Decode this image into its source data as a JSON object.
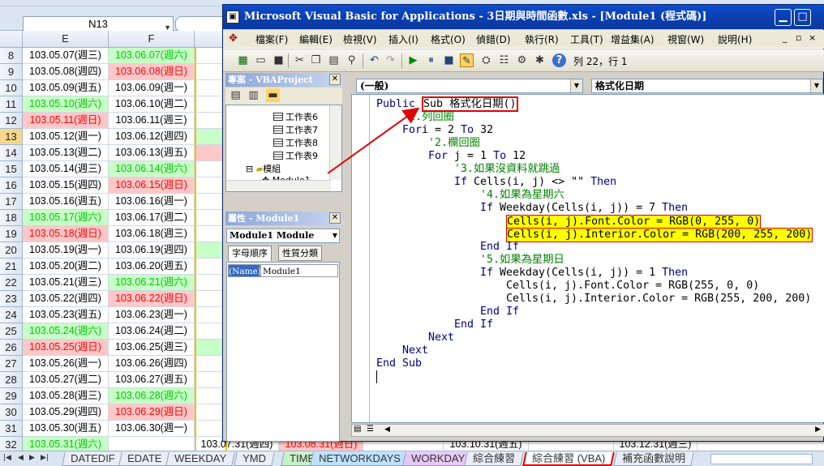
{
  "excel": {
    "name_box": "N13",
    "columns": [
      "E",
      "F"
    ],
    "active_row": "13",
    "rows": [
      {
        "num": "8",
        "e": "103.05.07(週三)",
        "ec": "",
        "f": "103.06.07(週六)",
        "fc": "sat"
      },
      {
        "num": "9",
        "e": "103.05.08(週四)",
        "ec": "",
        "f": "103.06.08(週日)",
        "fc": "sun"
      },
      {
        "num": "10",
        "e": "103.05.09(週五)",
        "ec": "",
        "f": "103.06.09(週一)",
        "fc": ""
      },
      {
        "num": "11",
        "e": "103.05.10(週六)",
        "ec": "sat",
        "f": "103.06.10(週二)",
        "fc": ""
      },
      {
        "num": "12",
        "e": "103.05.11(週日)",
        "ec": "sun",
        "f": "103.06.11(週三)",
        "fc": ""
      },
      {
        "num": "13",
        "e": "103.05.12(週一)",
        "ec": "",
        "f": "103.06.12(週四)",
        "fc": ""
      },
      {
        "num": "14",
        "e": "103.05.13(週二)",
        "ec": "",
        "f": "103.06.13(週五)",
        "fc": ""
      },
      {
        "num": "15",
        "e": "103.05.14(週三)",
        "ec": "",
        "f": "103.06.14(週六)",
        "fc": "sat"
      },
      {
        "num": "16",
        "e": "103.05.15(週四)",
        "ec": "",
        "f": "103.06.15(週日)",
        "fc": "sun"
      },
      {
        "num": "17",
        "e": "103.05.16(週五)",
        "ec": "",
        "f": "103.06.16(週一)",
        "fc": ""
      },
      {
        "num": "18",
        "e": "103.05.17(週六)",
        "ec": "sat",
        "f": "103.06.17(週二)",
        "fc": ""
      },
      {
        "num": "19",
        "e": "103.05.18(週日)",
        "ec": "sun",
        "f": "103.06.18(週三)",
        "fc": ""
      },
      {
        "num": "20",
        "e": "103.05.19(週一)",
        "ec": "",
        "f": "103.06.19(週四)",
        "fc": ""
      },
      {
        "num": "21",
        "e": "103.05.20(週二)",
        "ec": "",
        "f": "103.06.20(週五)",
        "fc": ""
      },
      {
        "num": "22",
        "e": "103.05.21(週三)",
        "ec": "",
        "f": "103.06.21(週六)",
        "fc": "sat"
      },
      {
        "num": "23",
        "e": "103.05.22(週四)",
        "ec": "",
        "f": "103.06.22(週日)",
        "fc": "sun"
      },
      {
        "num": "24",
        "e": "103.05.23(週五)",
        "ec": "",
        "f": "103.06.23(週一)",
        "fc": ""
      },
      {
        "num": "25",
        "e": "103.05.24(週六)",
        "ec": "sat",
        "f": "103.06.24(週二)",
        "fc": ""
      },
      {
        "num": "26",
        "e": "103.05.25(週日)",
        "ec": "sun",
        "f": "103.06.25(週三)",
        "fc": ""
      },
      {
        "num": "27",
        "e": "103.05.26(週一)",
        "ec": "",
        "f": "103.06.26(週四)",
        "fc": ""
      },
      {
        "num": "28",
        "e": "103.05.27(週二)",
        "ec": "",
        "f": "103.06.27(週五)",
        "fc": ""
      },
      {
        "num": "29",
        "e": "103.05.28(週三)",
        "ec": "",
        "f": "103.06.28(週六)",
        "fc": "sat"
      },
      {
        "num": "30",
        "e": "103.05.29(週四)",
        "ec": "",
        "f": "103.06.29(週日)",
        "fc": "sun"
      },
      {
        "num": "31",
        "e": "103.05.30(週五)",
        "ec": "",
        "f": "103.06.30(週一)",
        "fc": ""
      },
      {
        "num": "32",
        "e": "103.05.31(週六)",
        "ec": "sat",
        "f": "",
        "fc": ""
      }
    ],
    "peek_g": [
      "",
      "",
      "",
      "",
      "",
      "sat",
      "sun",
      "",
      "",
      "",
      "",
      "",
      "sat",
      "",
      "",
      "",
      "",
      "",
      "sat",
      "",
      "",
      "",
      "",
      "",
      ""
    ],
    "row32_extra": [
      "103.07.31(週四)",
      "103.08.31(週日)",
      "103.10.31(週五)",
      "103.12.31(週三)"
    ],
    "sheet_tabs": [
      "DATEDIF",
      "EDATE",
      "WEEKDAY",
      "YMD",
      "TIME",
      "NETWORKDAYS",
      "WORKDAY",
      "綜合練習",
      "綜合練習 (VBA)",
      "補充函數說明"
    ],
    "active_tab": "綜合練習 (VBA)",
    "tab_colors": {
      "TIME": "#c8f0c8",
      "NETWORKDAYS": "#bde1ff",
      "WORKDAY": "#e8c8f8"
    }
  },
  "vba": {
    "title": "Microsoft Visual Basic for Applications - 3日期與時間函數.xls - [Module1 (程式碼)]",
    "menu": [
      "檔案(F)",
      "編輯(E)",
      "檢視(V)",
      "插入(I)",
      "格式(O)",
      "偵錯(D)",
      "執行(R)",
      "工具(T)",
      "增益集(A)",
      "視窗(W)",
      "說明(H)"
    ],
    "position": "列 22，行 1",
    "project_title": "專案 - VBAProject",
    "tree": [
      "工作表6",
      "工作表7",
      "工作表8",
      "工作表9"
    ],
    "modules_folder": "模組",
    "module_item": "Module1",
    "props_title": "屬性 - Module1",
    "props_combo": "Module1 Module",
    "props_tabs": [
      "字母順序",
      "性質分類"
    ],
    "props_name_key": "(Name)",
    "props_name_val": "Module1",
    "combo_object": "(一般)",
    "combo_proc": "格式化日期",
    "code": [
      {
        "indent": 0,
        "parts": [
          [
            "kw",
            "Public "
          ],
          [
            "box",
            "Sub 格式化日期()"
          ]
        ]
      },
      {
        "indent": 1,
        "parts": [
          [
            "cm",
            "'1.列回圈"
          ]
        ]
      },
      {
        "indent": 1,
        "parts": [
          [
            "kw",
            "For"
          ],
          [
            "",
            "i = 2 "
          ],
          [
            "kw",
            "To"
          ],
          [
            "",
            " 32"
          ]
        ]
      },
      {
        "indent": 2,
        "parts": [
          [
            "cm",
            "'2.欄回圈"
          ]
        ]
      },
      {
        "indent": 2,
        "parts": [
          [
            "kw",
            "For"
          ],
          [
            "",
            " j = 1 "
          ],
          [
            "kw",
            "To"
          ],
          [
            "",
            " 12"
          ]
        ]
      },
      {
        "indent": 3,
        "parts": [
          [
            "cm",
            "'3.如果沒資料就跳過"
          ]
        ]
      },
      {
        "indent": 3,
        "parts": [
          [
            "kw",
            "If"
          ],
          [
            "",
            " Cells(i, j) <> \"\" "
          ],
          [
            "kw",
            "Then"
          ]
        ]
      },
      {
        "indent": 4,
        "parts": [
          [
            "cm",
            "'4.如果為星期六"
          ]
        ]
      },
      {
        "indent": 4,
        "parts": [
          [
            "kw",
            "If"
          ],
          [
            "",
            " Weekday(Cells(i, j)) = 7 "
          ],
          [
            "kw",
            "Then"
          ]
        ]
      },
      {
        "indent": 5,
        "parts": [
          [
            "hl",
            "Cells(i, j).Font.Color = RGB(0, 255, 0)"
          ]
        ]
      },
      {
        "indent": 5,
        "parts": [
          [
            "hl",
            "Cells(i, j).Interior.Color = RGB(200, 255, 200)"
          ]
        ]
      },
      {
        "indent": 4,
        "parts": [
          [
            "kw",
            "End If"
          ]
        ]
      },
      {
        "indent": 4,
        "parts": [
          [
            "cm",
            "'5.如果為星期日"
          ]
        ]
      },
      {
        "indent": 4,
        "parts": [
          [
            "kw",
            "If"
          ],
          [
            "",
            " Weekday(Cells(i, j)) = 1 "
          ],
          [
            "kw",
            "Then"
          ]
        ]
      },
      {
        "indent": 5,
        "parts": [
          [
            "",
            "Cells(i, j).Font.Color = RGB(255, 0, 0)"
          ]
        ]
      },
      {
        "indent": 5,
        "parts": [
          [
            "",
            "Cells(i, j).Interior.Color = RGB(255, 200, 200)"
          ]
        ]
      },
      {
        "indent": 4,
        "parts": [
          [
            "kw",
            "End If"
          ]
        ]
      },
      {
        "indent": 3,
        "parts": [
          [
            "kw",
            "End If"
          ]
        ]
      },
      {
        "indent": 2,
        "parts": [
          [
            "kw",
            "Next"
          ]
        ]
      },
      {
        "indent": 1,
        "parts": [
          [
            "kw",
            "Next"
          ]
        ]
      },
      {
        "indent": 0,
        "parts": [
          [
            "kw",
            "End Sub"
          ]
        ]
      }
    ],
    "colors": {
      "sat_fg": "#00c800",
      "sat_bg": "#c8ffc8",
      "sun_fg": "#ff0000",
      "sun_bg": "#ffc8c8",
      "annotation": "#e00000",
      "highlight": "#ffff00"
    }
  }
}
